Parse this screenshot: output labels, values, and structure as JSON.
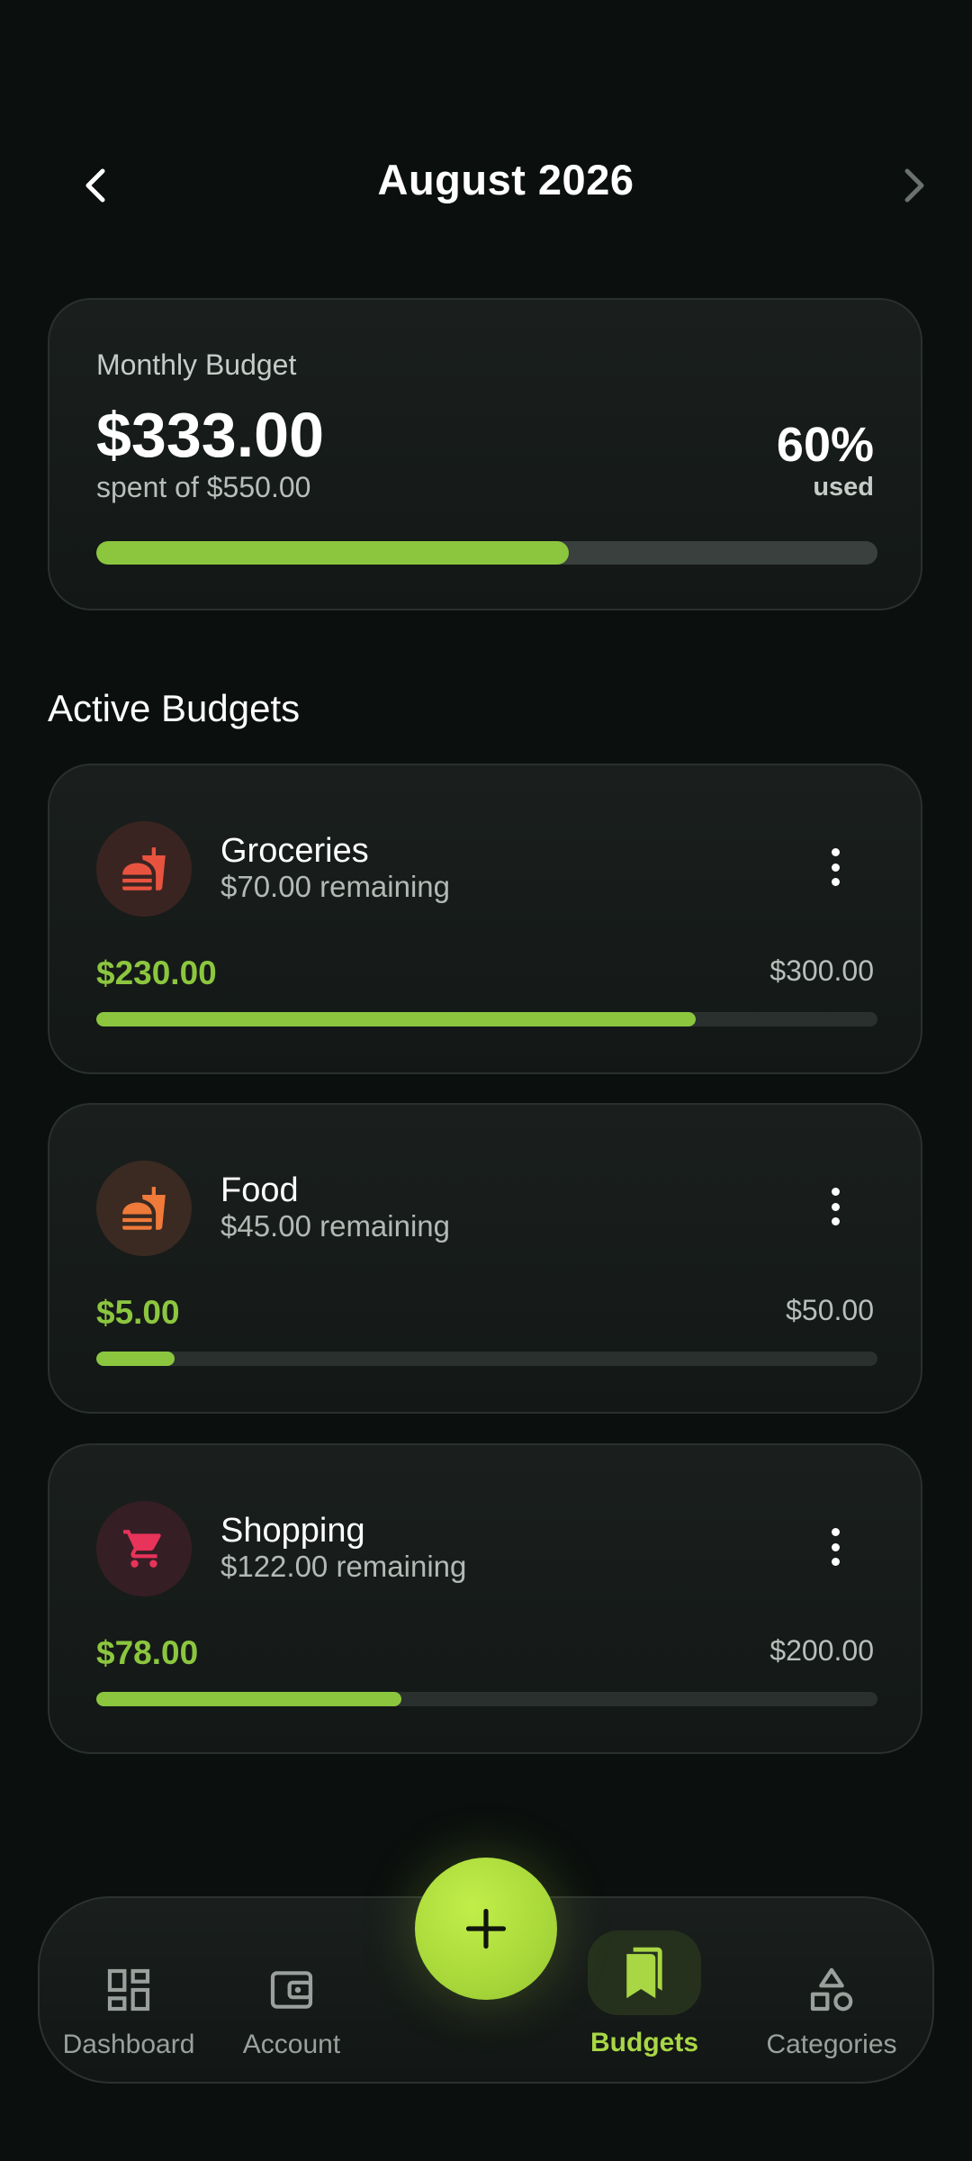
{
  "header": {
    "month": "August 2026"
  },
  "summary": {
    "label": "Monthly Budget",
    "spent": "$333.00",
    "of_text": "spent of $550.00",
    "percent": "60%",
    "used_label": "used",
    "progress_fraction": 0.605
  },
  "section_title": "Active Budgets",
  "budgets": [
    {
      "name": "Groceries",
      "remaining": "$70.00 remaining",
      "spent": "$230.00",
      "limit": "$300.00",
      "progress_fraction": 0.767,
      "icon": "fastfood-icon",
      "icon_color": "#e8533f",
      "icon_bg": "#3a2421"
    },
    {
      "name": "Food",
      "remaining": "$45.00 remaining",
      "spent": "$5.00",
      "limit": "$50.00",
      "progress_fraction": 0.1,
      "icon": "fastfood-icon",
      "icon_color": "#f07a3a",
      "icon_bg": "#3a2a21"
    },
    {
      "name": "Shopping",
      "remaining": "$122.00 remaining",
      "spent": "$78.00",
      "limit": "$200.00",
      "progress_fraction": 0.39,
      "icon": "shopping-cart-icon",
      "icon_color": "#e8335a",
      "icon_bg": "#361e25"
    }
  ],
  "nav": {
    "items": [
      {
        "label": "Dashboard",
        "icon": "dashboard-icon",
        "active": false
      },
      {
        "label": "Account",
        "icon": "wallet-icon",
        "active": false
      },
      {
        "label": "Budgets",
        "icon": "budgets-icon",
        "active": true
      },
      {
        "label": "Categories",
        "icon": "categories-icon",
        "active": false
      }
    ],
    "fab_icon": "plus-icon"
  },
  "colors": {
    "accent": "#8cc63f",
    "fab": "#b2e03d",
    "background": "#0b0f0e"
  }
}
